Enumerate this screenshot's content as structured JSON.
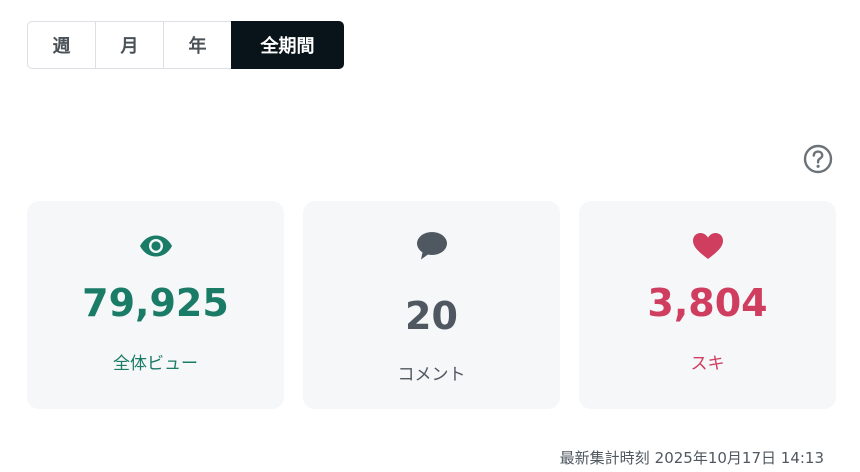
{
  "period_tabs": [
    {
      "label": "週",
      "active": false
    },
    {
      "label": "月",
      "active": false
    },
    {
      "label": "年",
      "active": false
    },
    {
      "label": "全期間",
      "active": true
    }
  ],
  "stats": {
    "views": {
      "value": "79,925",
      "label": "全体ビュー",
      "icon": "eye-icon",
      "color": "#1a7b66"
    },
    "comments": {
      "value": "20",
      "label": "コメント",
      "icon": "speech-bubble-icon",
      "color": "#4f5860"
    },
    "likes": {
      "value": "3,804",
      "label": "スキ",
      "icon": "heart-icon",
      "color": "#cf3d5f"
    }
  },
  "help": {
    "icon": "question-circle-icon"
  },
  "updated": {
    "label": "最新集計時刻",
    "timestamp": "2025年10月17日 14:13"
  },
  "colors": {
    "active_tab_bg": "#08131a",
    "card_bg": "#f5f7f9"
  }
}
